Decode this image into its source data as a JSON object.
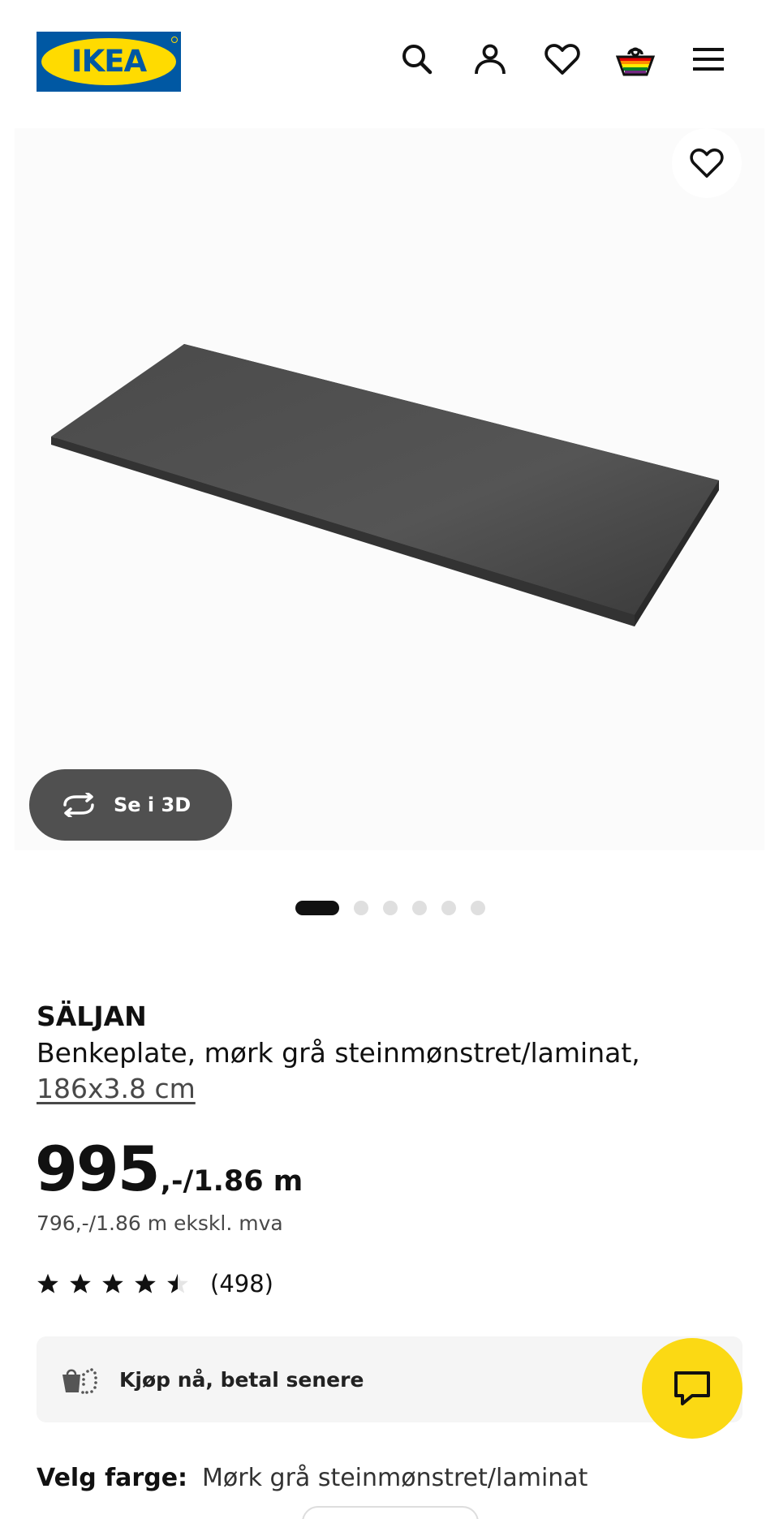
{
  "header": {
    "logo_text": "IKEA",
    "icons": [
      "search-icon",
      "profile-icon",
      "heart-icon",
      "shopping-bag-icon",
      "menu-icon"
    ],
    "brand_colors": {
      "blue": "#0058a3",
      "yellow": "#ffdb00"
    }
  },
  "gallery": {
    "see_3d_label": "Se i 3D",
    "slide_count": 6,
    "active_slide": 1
  },
  "product": {
    "name": "SÄLJAN",
    "description": "Benkeplate, mørk grå steinmønstret/laminat,",
    "size": "186x3.8 cm",
    "price_main": "995",
    "price_suffix": ",-/1.86 m",
    "price_ex_vat": "796,-/1.86 m ekskl. mva",
    "rating": 4.5,
    "review_count": "(498)"
  },
  "bnpl": {
    "label": "Kjøp nå, betal senere"
  },
  "color": {
    "label": "Velg farge:",
    "value": "Mørk grå steinmønstret/laminat"
  },
  "chat": {
    "accent": "#fbd914"
  }
}
